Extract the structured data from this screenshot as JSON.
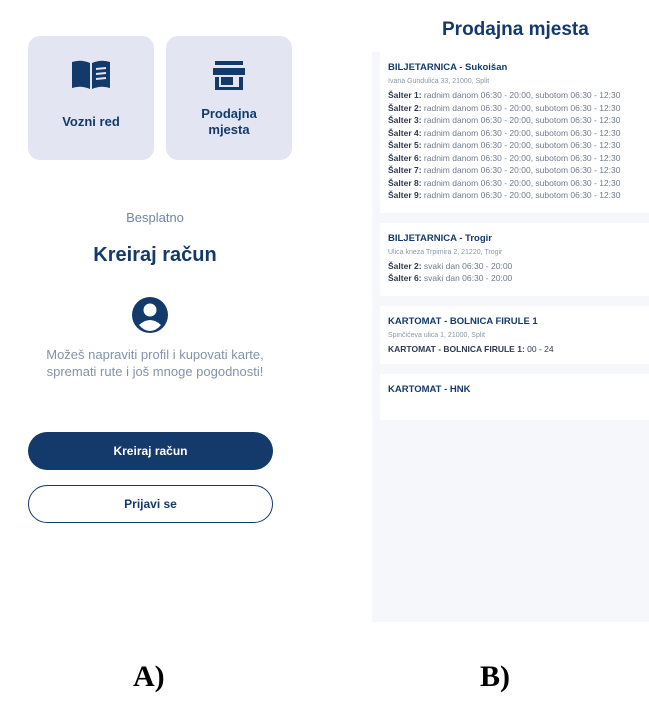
{
  "panel_a": {
    "tiles": [
      {
        "label": "Vozni red",
        "icon": "book-icon"
      },
      {
        "label": "Prodajna\nmjesta",
        "icon": "store-icon"
      }
    ],
    "free_label": "Besplatno",
    "heading": "Kreiraj račun",
    "avatar_icon": "account-circle-icon",
    "description": "Možeš napraviti profil i kupovati karte, spremati rute i još mnoge pogodnosti!",
    "create_button": "Kreiraj račun",
    "login_button": "Prijavi se"
  },
  "panel_b": {
    "title": "Prodajna mjesta",
    "locations": [
      {
        "name": "BILJETARNICA - Sukoišan",
        "address": "Ivana Gundulića 33, 21000, Split",
        "shifts": [
          {
            "label": "Šalter 1:",
            "hours": " radnim danom 06:30 - 20:00, subotom 06:30 - 12:30"
          },
          {
            "label": "Šalter 2:",
            "hours": " radnim danom 06:30 - 20:00, subotom 06:30 - 12:30"
          },
          {
            "label": "Šalter 3:",
            "hours": " radnim danom 06:30 - 20:00, subotom 06:30 - 12:30"
          },
          {
            "label": "Šalter 4:",
            "hours": " radnim danom 06:30 - 20:00, subotom 06:30 - 12:30"
          },
          {
            "label": "Šalter 5:",
            "hours": " radnim danom 06:30 - 20:00, subotom 06:30 - 12:30"
          },
          {
            "label": "Šalter 6:",
            "hours": " radnim danom 06:30 - 20:00, subotom 06:30 - 12:30"
          },
          {
            "label": "Šalter 7:",
            "hours": " radnim danom 06:30 - 20:00, subotom 06:30 - 12:30"
          },
          {
            "label": "Šalter 8:",
            "hours": " radnim danom 06:30 - 20:00, subotom 06:30 - 12:30"
          },
          {
            "label": "Šalter 9:",
            "hours": " radnim danom 06:30 - 20:00, subotom 06:30 - 12:30"
          }
        ]
      },
      {
        "name": "BILJETARNICA - Trogir",
        "address": "Ulica kneza Trpimira 2, 21220, Trogir",
        "shifts": [
          {
            "label": "Šalter 2:",
            "hours": " svaki dan 06:30 - 20:00"
          },
          {
            "label": "Šalter 6:",
            "hours": " svaki dan 06:30 - 20:00"
          }
        ]
      },
      {
        "name": "KARTOMAT - BOLNICA FIRULE 1",
        "address": "Spinčićeva ulica 1, 21000, Split",
        "kiosk": {
          "label": "KARTOMAT - BOLNICA FIRULE 1:",
          "hours": " 00 - 24"
        }
      },
      {
        "name": "KARTOMAT - HNK"
      }
    ]
  },
  "captions": {
    "a": "A)",
    "b": "B)"
  },
  "colors": {
    "primary": "#143a6b",
    "tile_bg": "#e3e6f2",
    "muted": "#8293ab"
  }
}
